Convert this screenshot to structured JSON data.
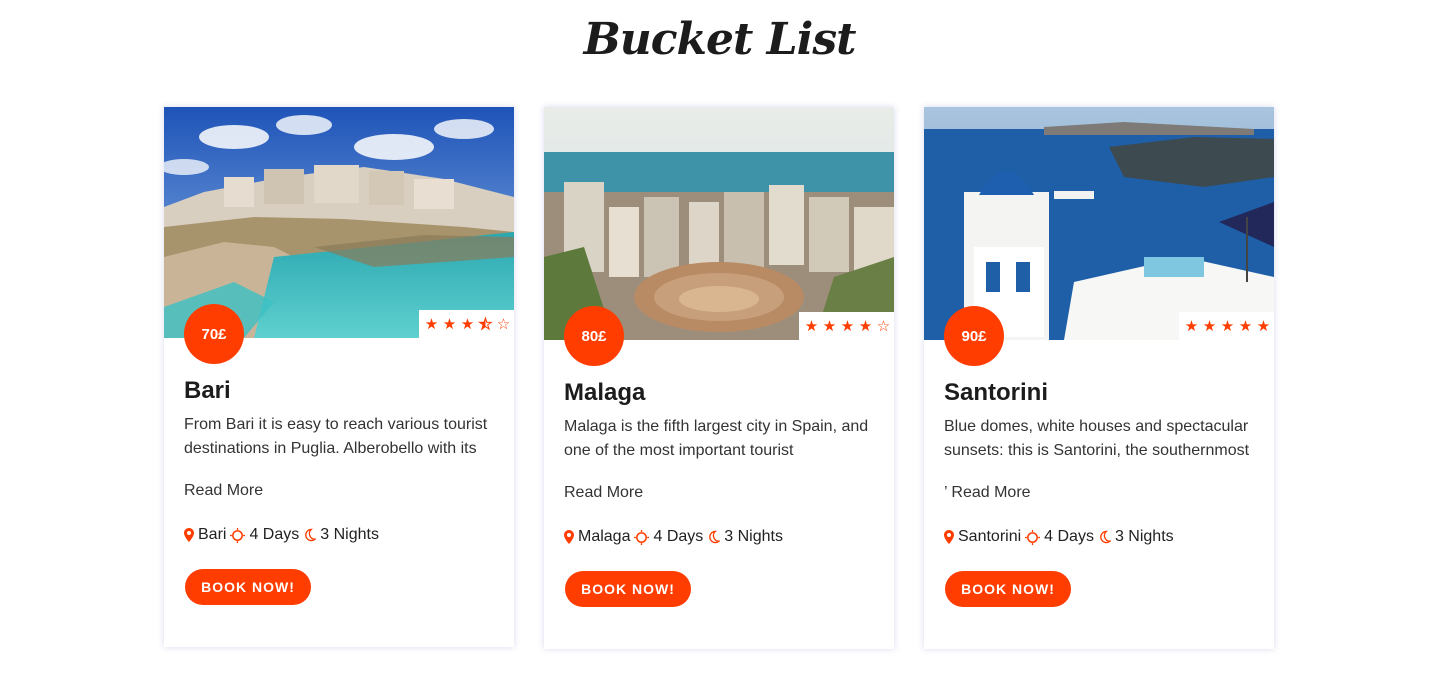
{
  "page": {
    "title": "Bucket List"
  },
  "colors": {
    "accent": "#ff3d00",
    "text": "#222222",
    "card_shadow": "#b4b4e6"
  },
  "cards": [
    {
      "price": "70£",
      "rating": 3.5,
      "title": "Bari",
      "description": "From Bari it is easy to reach various tourist destinations in Puglia. Alberobello with its",
      "read_more": "Read More",
      "location": "Bari",
      "days": "4 Days",
      "nights": "3 Nights",
      "book_label": "BOOK NOW!",
      "image_icon": "coastal-cliff-town-photo"
    },
    {
      "price": "80£",
      "rating": 4,
      "title": "Malaga",
      "description": "Malaga is the fifth largest city in Spain, and one of the most important tourist",
      "read_more": "Read More",
      "location": "Malaga",
      "days": "4 Days",
      "nights": "3 Nights",
      "book_label": "BOOK NOW!",
      "image_icon": "city-bullring-photo"
    },
    {
      "price": "90£",
      "rating": 5,
      "title": "Santorini",
      "description": "Blue domes, white houses and spectacular sunsets: this is Santorini, the southernmost",
      "read_more": "’ Read More",
      "location": "Santorini",
      "days": "4 Days",
      "nights": "3 Nights",
      "book_label": "BOOK NOW!",
      "image_icon": "blue-dome-caldera-photo"
    }
  ]
}
